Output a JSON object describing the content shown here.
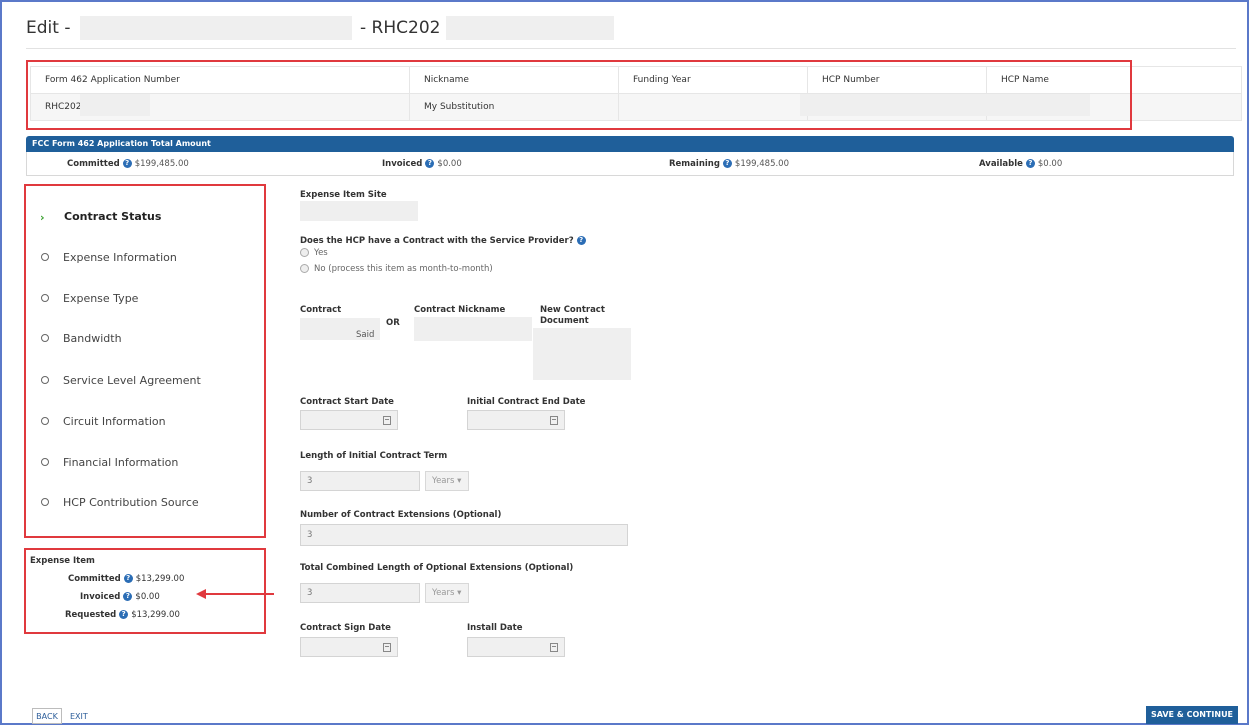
{
  "page": {
    "title_prefix": "Edit -",
    "title_suffix": "- RHC202"
  },
  "header_table": {
    "columns": [
      "Form 462 Application Number",
      "Nickname",
      "Funding Year",
      "HCP Number",
      "HCP Name"
    ],
    "values": [
      "RHC202",
      "My Substitution",
      "",
      "",
      ""
    ]
  },
  "totals": {
    "bar_title": "FCC Form 462 Application Total Amount",
    "committed_label": "Committed",
    "committed_value": "$199,485.00",
    "invoiced_label": "Invoiced",
    "invoiced_value": "$0.00",
    "remaining_label": "Remaining",
    "remaining_value": "$199,485.00",
    "available_label": "Available",
    "available_value": "$0.00"
  },
  "nav": {
    "items": [
      {
        "label": "Contract Status",
        "active": true
      },
      {
        "label": "Expense Information"
      },
      {
        "label": "Expense Type"
      },
      {
        "label": "Bandwidth"
      },
      {
        "label": "Service Level Agreement"
      },
      {
        "label": "Circuit Information"
      },
      {
        "label": "Financial Information"
      },
      {
        "label": "HCP Contribution Source"
      }
    ]
  },
  "expense_item": {
    "title": "Expense Item",
    "committed_label": "Committed",
    "committed_value": "$13,299.00",
    "invoiced_label": "Invoiced",
    "invoiced_value": "$0.00",
    "requested_label": "Requested",
    "requested_value": "$13,299.00"
  },
  "form": {
    "expense_item_site_label": "Expense Item Site",
    "contract_question": "Does the HCP have a Contract with the Service Provider?",
    "option_yes": "Yes",
    "option_no": "No (process this item as month-to-month)",
    "contract_label": "Contract",
    "contract_value": "Said",
    "or_text": "OR",
    "contract_nickname_label": "Contract Nickname",
    "new_contract_document_label": "New Contract Document",
    "contract_start_date_label": "Contract Start Date",
    "initial_contract_end_date_label": "Initial Contract End Date",
    "length_initial_term_label": "Length of Initial Contract Term",
    "length_initial_term_value": "3",
    "length_initial_term_unit": "Years",
    "num_extensions_label": "Number of Contract Extensions (Optional)",
    "num_extensions_value": "3",
    "total_ext_length_label": "Total Combined Length of Optional Extensions (Optional)",
    "total_ext_length_value": "3",
    "total_ext_length_unit": "Years",
    "contract_sign_date_label": "Contract Sign Date",
    "install_date_label": "Install Date"
  },
  "footer": {
    "back_label": "BACK",
    "exit_label": "EXIT",
    "save_continue_label": "SAVE & CONTINUE"
  },
  "colors": {
    "primary_blue": "#1f5f9a",
    "highlight_red": "#e0393e",
    "active_chevron": "#3aa02f",
    "frame_border": "#5b79c9"
  }
}
